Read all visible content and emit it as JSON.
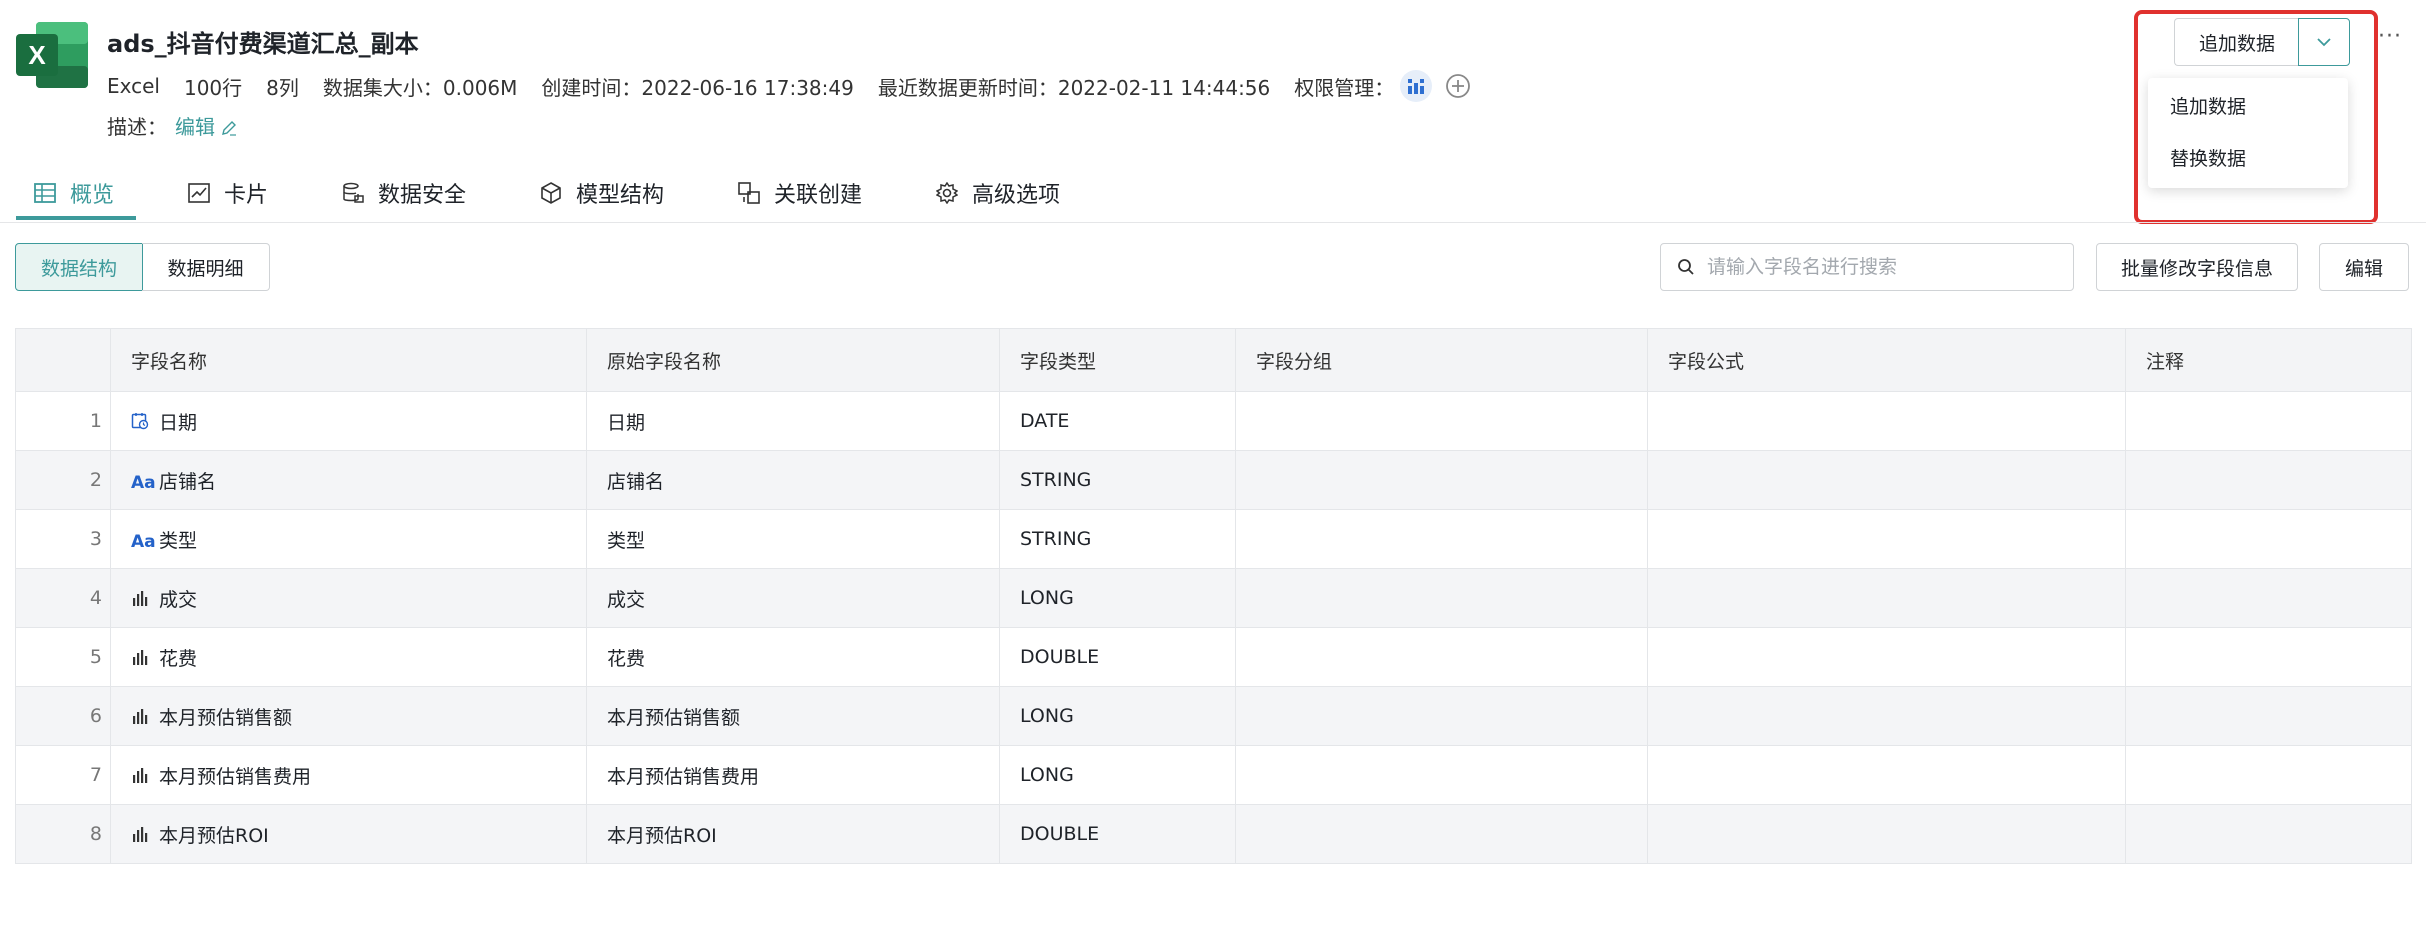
{
  "header": {
    "title": "ads_抖音付费渠道汇总_副本",
    "meta": {
      "type": "Excel",
      "rows": "100行",
      "cols": "8列",
      "size": "数据集大小：0.006M",
      "created": "创建时间：2022-06-16 17:38:49",
      "updated": "最近数据更新时间：2022-02-11 14:44:56",
      "permission_label": "权限管理："
    },
    "desc_label": "描述：",
    "desc_edit": "编辑"
  },
  "actions": {
    "append_label": "追加数据",
    "menu": [
      "追加数据",
      "替换数据"
    ],
    "more": "···"
  },
  "tabs": [
    {
      "label": "概览",
      "icon": "table-icon"
    },
    {
      "label": "卡片",
      "icon": "line-chart-icon"
    },
    {
      "label": "数据安全",
      "icon": "database-lock-icon"
    },
    {
      "label": "模型结构",
      "icon": "cube-icon"
    },
    {
      "label": "关联创建",
      "icon": "link-icon"
    },
    {
      "label": "高级选项",
      "icon": "gear-icon"
    }
  ],
  "subtabs": [
    "数据结构",
    "数据明细"
  ],
  "search": {
    "placeholder": "请输入字段名进行搜索"
  },
  "toolbar": {
    "batch_label": "批量修改字段信息",
    "edit_label": "编辑"
  },
  "table": {
    "headers": [
      "",
      "字段名称",
      "原始字段名称",
      "字段类型",
      "字段分组",
      "字段公式",
      "注释"
    ],
    "rows": [
      {
        "idx": "1",
        "icon": "date",
        "name": "日期",
        "orig": "日期",
        "type": "DATE"
      },
      {
        "idx": "2",
        "icon": "text",
        "name": "店铺名",
        "orig": "店铺名",
        "type": "STRING"
      },
      {
        "idx": "3",
        "icon": "text",
        "name": "类型",
        "orig": "类型",
        "type": "STRING"
      },
      {
        "idx": "4",
        "icon": "measure",
        "name": "成交",
        "orig": "成交",
        "type": "LONG"
      },
      {
        "idx": "5",
        "icon": "measure",
        "name": "花费",
        "orig": "花费",
        "type": "DOUBLE"
      },
      {
        "idx": "6",
        "icon": "measure",
        "name": "本月预估销售额",
        "orig": "本月预估销售额",
        "type": "LONG"
      },
      {
        "idx": "7",
        "icon": "measure",
        "name": "本月预估销售费用",
        "orig": "本月预估销售费用",
        "type": "LONG"
      },
      {
        "idx": "8",
        "icon": "measure",
        "name": "本月预估ROI",
        "orig": "本月预估ROI",
        "type": "DOUBLE"
      }
    ]
  },
  "colors": {
    "accent": "#3d9a9b",
    "highlight": "#e0312e",
    "excel": "#1f7244"
  }
}
